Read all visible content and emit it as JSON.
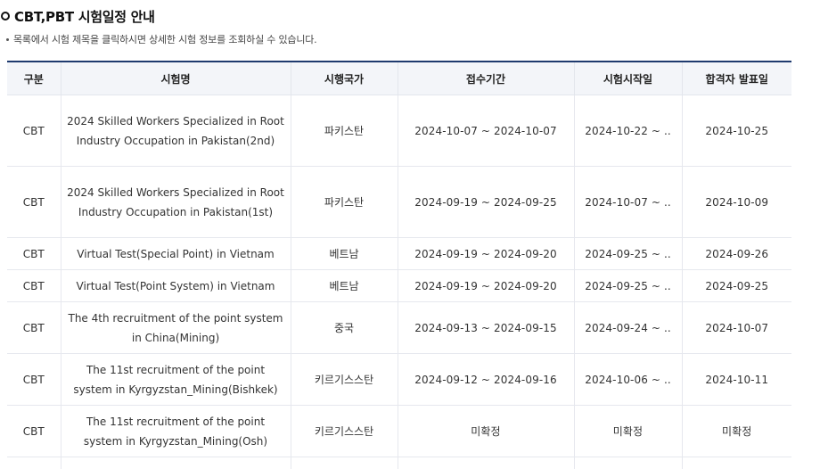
{
  "section": {
    "title": "CBT,PBT 시험일정 안내",
    "description": "목록에서 시험 제목을 클릭하시면 상세한 시험 정보를 조회하실 수 있습니다."
  },
  "table": {
    "headers": [
      "구분",
      "시험명",
      "시행국가",
      "접수기간",
      "시험시작일",
      "합격자 발표일"
    ],
    "rows": [
      {
        "type": "CBT",
        "name": "2024 Skilled Workers Specialized in Root Industry Occupation in Pakistan(2nd)",
        "country": "파키스탄",
        "period": "2024-10-07 ~ 2024-10-07",
        "start": "2024-10-22 ~ ..",
        "announce": "2024-10-25"
      },
      {
        "type": "CBT",
        "name": "2024 Skilled Workers Specialized in Root Industry Occupation in Pakistan(1st)",
        "country": "파키스탄",
        "period": "2024-09-19 ~ 2024-09-25",
        "start": "2024-10-07 ~ ..",
        "announce": "2024-10-09"
      },
      {
        "type": "CBT",
        "name": "Virtual Test(Special Point) in Vietnam",
        "country": "베트남",
        "period": "2024-09-19 ~ 2024-09-20",
        "start": "2024-09-25 ~ ..",
        "announce": "2024-09-26"
      },
      {
        "type": "CBT",
        "name": "Virtual Test(Point System) in Vietnam",
        "country": "베트남",
        "period": "2024-09-19 ~ 2024-09-20",
        "start": "2024-09-25 ~ ..",
        "announce": "2024-09-25"
      },
      {
        "type": "CBT",
        "name": "The 4th recruitment of the point system in China(Mining)",
        "country": "중국",
        "period": "2024-09-13 ~ 2024-09-15",
        "start": "2024-09-24 ~ ..",
        "announce": "2024-10-07"
      },
      {
        "type": "CBT",
        "name": "The 11st recruitment of the point system in Kyrgyzstan_Mining(Bishkek)",
        "country": "키르기스스탄",
        "period": "2024-09-12 ~ 2024-09-16",
        "start": "2024-10-06 ~ ..",
        "announce": "2024-10-11"
      },
      {
        "type": "CBT",
        "name": "The 11st recruitment of the point system in Kyrgyzstan_Mining(Osh)",
        "country": "키르기스스탄",
        "period": "미확정",
        "start": "미확정",
        "announce": "미확정"
      }
    ]
  }
}
